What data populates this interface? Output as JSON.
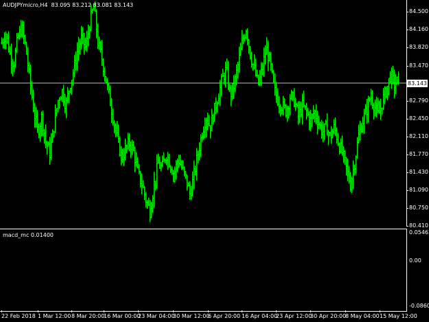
{
  "chart": {
    "symbol_label": "AUDJPYmicro,H4",
    "ohlc_label": "83.095 83.212 83.081 83.143",
    "current_price": "83.143"
  },
  "indicator": {
    "name": "macd_mc",
    "value": "0.01400",
    "y_labels": [
      "0.05462",
      "0.00",
      "-0.08608"
    ]
  },
  "colors": {
    "background": "#000000",
    "bars": "#00ff00",
    "grid": "#ffffff"
  },
  "chart_data": {
    "type": "ohlc",
    "price_labels": [
      "84.500",
      "84.160",
      "83.820",
      "83.470",
      "83.143",
      "82.790",
      "82.450",
      "82.110",
      "81.770",
      "81.430",
      "81.090",
      "80.750",
      "80.410"
    ],
    "x_labels": [
      "22 Feb 2018",
      "1 Mar 12:00",
      "8 Mar 20:00",
      "16 Mar 00:00",
      "23 Mar 04:00",
      "30 Mar 12:00",
      "6 Apr 20:00",
      "16 Apr 04:00",
      "23 Apr 12:00",
      "30 Apr 20:00",
      "8 May 04:00",
      "15 May 12:00"
    ],
    "ylim": [
      80.41,
      84.5
    ],
    "series_close": [
      83.9,
      84.1,
      83.7,
      83.5,
      84.0,
      84.2,
      83.8,
      83.2,
      82.6,
      82.2,
      82.5,
      82.0,
      81.8,
      82.3,
      82.8,
      83.0,
      82.7,
      83.1,
      83.4,
      83.8,
      84.0,
      83.8,
      84.3,
      84.6,
      83.9,
      83.6,
      83.2,
      82.8,
      82.4,
      82.0,
      81.7,
      81.9,
      82.0,
      81.8,
      81.4,
      81.2,
      80.9,
      80.7,
      81.2,
      81.6,
      81.5,
      81.8,
      81.6,
      81.4,
      81.7,
      81.5,
      81.3,
      81.0,
      81.4,
      81.8,
      82.2,
      82.5,
      82.3,
      82.6,
      82.9,
      83.2,
      83.4,
      82.9,
      83.1,
      83.5,
      83.9,
      84.2,
      83.7,
      83.4,
      83.1,
      83.4,
      83.8,
      83.5,
      83.0,
      82.8,
      82.7,
      82.6,
      82.9,
      82.8,
      82.5,
      82.7,
      82.6,
      82.4,
      82.6,
      82.4,
      82.2,
      82.3,
      82.1,
      82.3,
      82.0,
      81.8,
      81.5,
      81.2,
      81.6,
      82.1,
      82.4,
      82.6,
      82.9,
      82.7,
      82.5,
      82.8,
      83.0,
      83.3,
      83.1,
      83.2
    ]
  }
}
